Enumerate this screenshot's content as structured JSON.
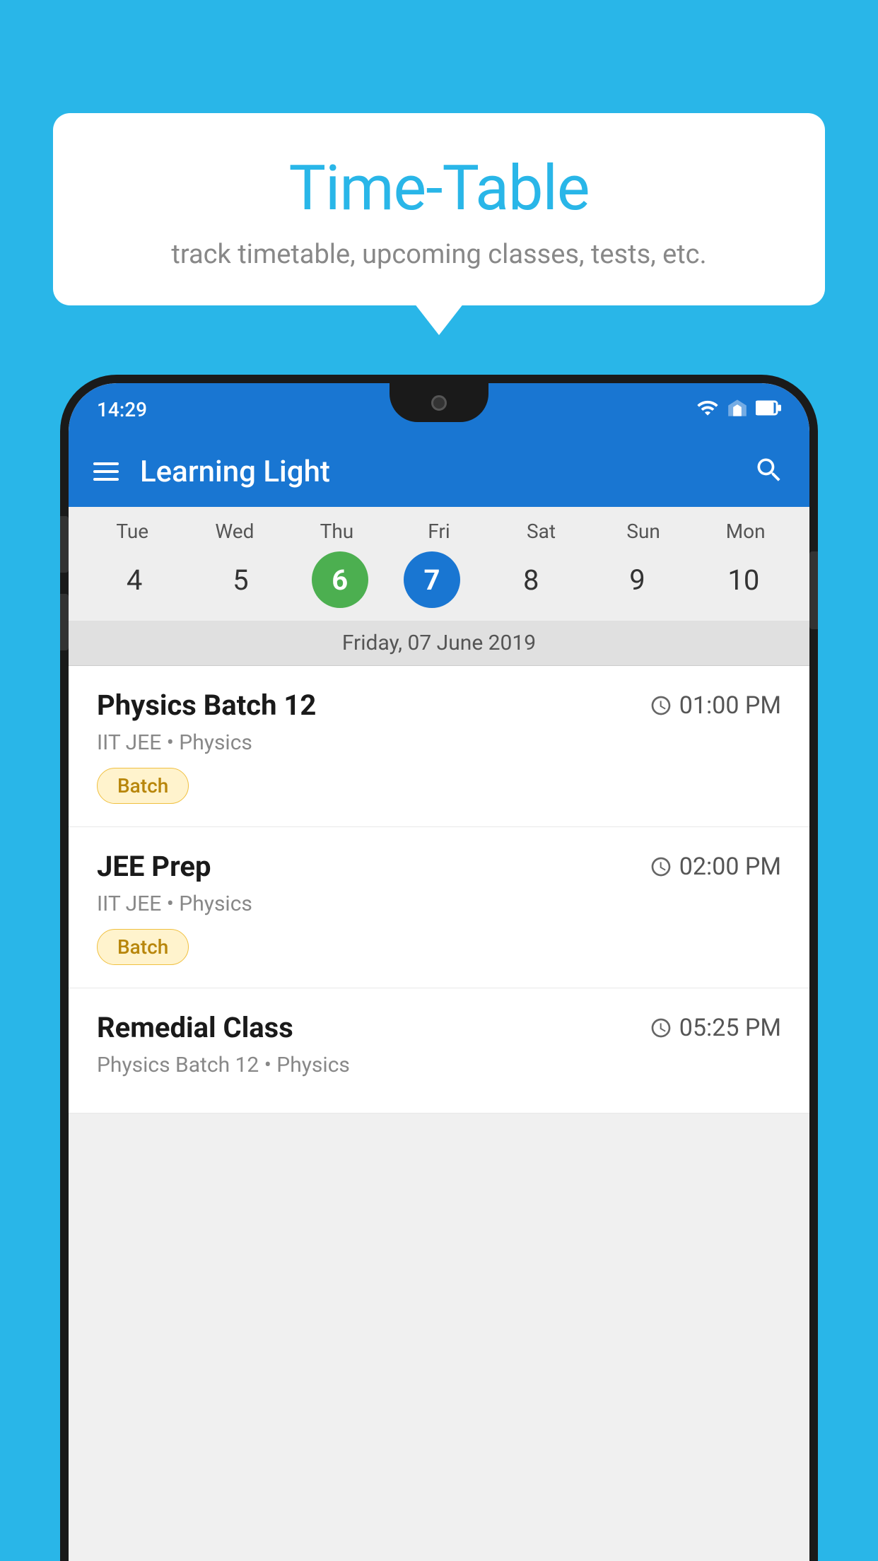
{
  "background_color": "#29b6e8",
  "speech_bubble": {
    "title": "Time-Table",
    "subtitle": "track timetable, upcoming classes, tests, etc."
  },
  "phone": {
    "status_bar": {
      "time": "14:29"
    },
    "toolbar": {
      "app_name": "Learning Light"
    },
    "calendar": {
      "days": [
        {
          "name": "Tue",
          "num": "4",
          "state": "normal"
        },
        {
          "name": "Wed",
          "num": "5",
          "state": "normal"
        },
        {
          "name": "Thu",
          "num": "6",
          "state": "today"
        },
        {
          "name": "Fri",
          "num": "7",
          "state": "selected"
        },
        {
          "name": "Sat",
          "num": "8",
          "state": "normal"
        },
        {
          "name": "Sun",
          "num": "9",
          "state": "normal"
        },
        {
          "name": "Mon",
          "num": "10",
          "state": "normal"
        }
      ],
      "selected_date_label": "Friday, 07 June 2019"
    },
    "classes": [
      {
        "name": "Physics Batch 12",
        "time": "01:00 PM",
        "meta": "IIT JEE • Physics",
        "badge": "Batch"
      },
      {
        "name": "JEE Prep",
        "time": "02:00 PM",
        "meta": "IIT JEE • Physics",
        "badge": "Batch"
      },
      {
        "name": "Remedial Class",
        "time": "05:25 PM",
        "meta": "Physics Batch 12 • Physics",
        "badge": ""
      }
    ]
  }
}
